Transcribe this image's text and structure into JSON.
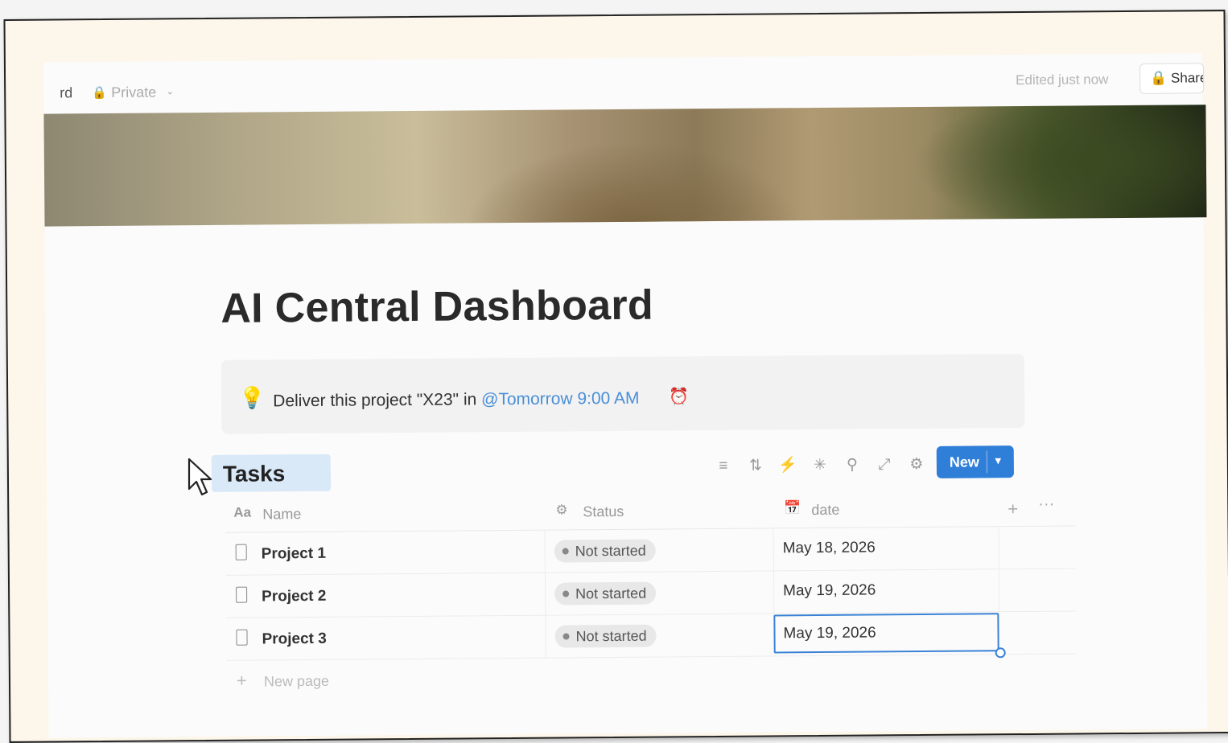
{
  "topbar": {
    "breadcrumb_fragment": "rd",
    "privacy_label": "Private",
    "edited_label": "Edited just now",
    "share_label": "Share"
  },
  "page": {
    "title": "AI Central Dashboard"
  },
  "callout": {
    "icon": "lightbulb-icon",
    "text_before": "Deliver this project \"X23\" in ",
    "mention": "@Tomorrow 9:00 AM",
    "reminder_icon": "alarm-clock-icon"
  },
  "database": {
    "title": "Tasks",
    "toolbar_icons": [
      "filter-icon",
      "sort-icon",
      "automation-icon",
      "ai-icon",
      "search-icon",
      "expand-icon",
      "settings-icon"
    ],
    "new_label": "New",
    "columns": [
      {
        "icon": "text-type-icon",
        "icon_text": "Aa",
        "label": "Name"
      },
      {
        "icon": "status-icon",
        "label": "Status"
      },
      {
        "icon": "calendar-icon",
        "label": "date"
      }
    ],
    "rows": [
      {
        "name": "Project 1",
        "status": "Not started",
        "date": "May 18, 2026"
      },
      {
        "name": "Project 2",
        "status": "Not started",
        "date": "May 19, 2026"
      },
      {
        "name": "Project 3",
        "status": "Not started",
        "date": "May 19, 2026",
        "selected": true
      }
    ],
    "new_page_label": "New page"
  },
  "colors": {
    "accent": "#2f7fd8",
    "mention": "#4a8fd8",
    "title_highlight": "#d9e9f8",
    "status_pill": "#e8e8e8"
  }
}
